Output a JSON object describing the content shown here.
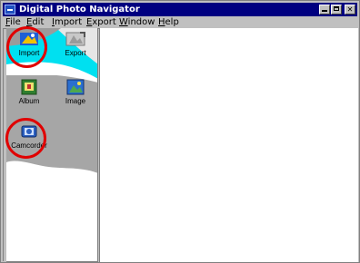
{
  "window": {
    "title": "Digital Photo Navigator"
  },
  "menu": {
    "items": [
      {
        "label": "File"
      },
      {
        "label": "Edit"
      },
      {
        "label": "Import"
      },
      {
        "label": "Export"
      },
      {
        "label": "Window"
      },
      {
        "label": "Help"
      }
    ]
  },
  "sidebar": {
    "tools": [
      {
        "label": "Import",
        "icon": "import-icon"
      },
      {
        "label": "Export",
        "icon": "export-icon"
      },
      {
        "label": "Album",
        "icon": "album-icon"
      },
      {
        "label": "Image",
        "icon": "image-icon"
      },
      {
        "label": "Camcorder",
        "icon": "camcorder-icon"
      }
    ]
  },
  "colors": {
    "titlebar": "#000080",
    "accent_cyan": "#00e0f0",
    "highlight": "#e00000"
  }
}
